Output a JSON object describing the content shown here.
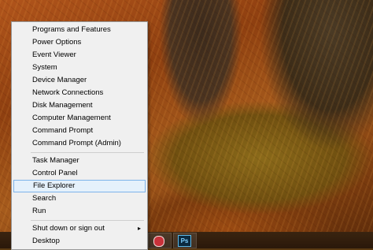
{
  "menu": {
    "group1": [
      "Programs and Features",
      "Power Options",
      "Event Viewer",
      "System",
      "Device Manager",
      "Network Connections",
      "Disk Management",
      "Computer Management",
      "Command Prompt",
      "Command Prompt (Admin)"
    ],
    "group2": [
      "Task Manager",
      "Control Panel",
      "File Explorer",
      "Search",
      "Run"
    ],
    "group3": [
      "Shut down or sign out",
      "Desktop"
    ],
    "submenu_arrow": "▸",
    "highlighted": "File Explorer"
  },
  "taskbar": {
    "ps_label": "Ps"
  }
}
